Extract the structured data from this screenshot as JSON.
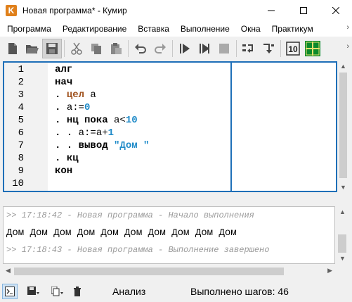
{
  "window": {
    "title": "Новая программа* - Кумир",
    "app_icon_letter": "K"
  },
  "menu": [
    "Программа",
    "Редактирование",
    "Вставка",
    "Выполнение",
    "Окна",
    "Практикум"
  ],
  "toolbar": {
    "icons": [
      "new-file-icon",
      "open-folder-icon",
      "save-icon",
      "cut-icon",
      "copy-icon",
      "paste-icon",
      "undo-icon",
      "redo-icon",
      "run-icon",
      "step-run-icon",
      "stop-icon",
      "step-over-icon",
      "step-into-icon",
      "robot-counter-icon",
      "grid-robot-icon"
    ]
  },
  "editor": {
    "line_numbers": [
      "1",
      "2",
      "3",
      "4",
      "5",
      "6",
      "7",
      "8",
      "9",
      "10"
    ],
    "lines": [
      [
        {
          "t": "алг",
          "c": "kw"
        }
      ],
      [
        {
          "t": "нач",
          "c": "kw"
        }
      ],
      [
        {
          "t": ". ",
          "c": "dot"
        },
        {
          "t": "цел",
          "c": "type"
        },
        {
          "t": " а",
          "c": "plain"
        }
      ],
      [
        {
          "t": ". ",
          "c": "dot"
        },
        {
          "t": "а:=",
          "c": "plain"
        },
        {
          "t": "0",
          "c": "num"
        }
      ],
      [
        {
          "t": ". ",
          "c": "dot"
        },
        {
          "t": "нц пока",
          "c": "kw"
        },
        {
          "t": " а<",
          "c": "plain"
        },
        {
          "t": "10",
          "c": "num"
        }
      ],
      [
        {
          "t": ". . ",
          "c": "dot"
        },
        {
          "t": "а:=а+",
          "c": "plain"
        },
        {
          "t": "1",
          "c": "num"
        }
      ],
      [
        {
          "t": ". . ",
          "c": "dot"
        },
        {
          "t": "вывод",
          "c": "kw"
        },
        {
          "t": " ",
          "c": "plain"
        },
        {
          "t": "\"Дом \"",
          "c": "str"
        }
      ],
      [
        {
          "t": ". ",
          "c": "dot"
        },
        {
          "t": "кц",
          "c": "kw"
        }
      ],
      [
        {
          "t": "кон",
          "c": "kw"
        }
      ],
      []
    ]
  },
  "console": {
    "start_msg": ">> 17:18:42 - Новая программа - Начало выполнения",
    "output": "Дом Дом Дом Дом Дом Дом Дом Дом Дом Дом",
    "end_msg": ">> 17:18:43 - Новая программа - Выполнение завершено"
  },
  "status": {
    "mode": "Анализ",
    "steps": "Выполнено шагов: 46"
  },
  "colors": {
    "editor_border": "#1e6fb8",
    "keyword": "#000000",
    "type": "#a0521e",
    "number": "#1e8ac8",
    "app_icon": "#e0801b"
  }
}
